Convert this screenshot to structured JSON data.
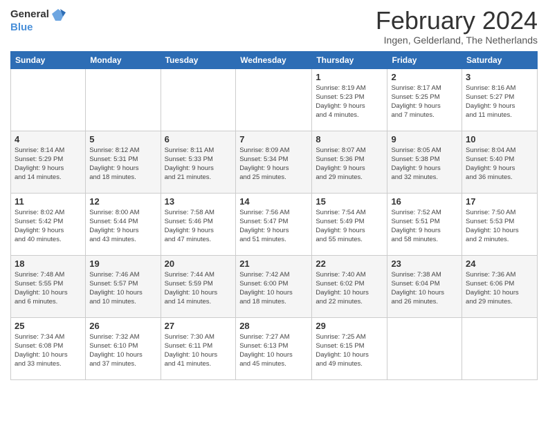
{
  "header": {
    "logo_line1": "General",
    "logo_line2": "Blue",
    "month_title": "February 2024",
    "location": "Ingen, Gelderland, The Netherlands"
  },
  "days_of_week": [
    "Sunday",
    "Monday",
    "Tuesday",
    "Wednesday",
    "Thursday",
    "Friday",
    "Saturday"
  ],
  "weeks": [
    {
      "days": [
        {
          "num": "",
          "info": ""
        },
        {
          "num": "",
          "info": ""
        },
        {
          "num": "",
          "info": ""
        },
        {
          "num": "",
          "info": ""
        },
        {
          "num": "1",
          "info": "Sunrise: 8:19 AM\nSunset: 5:23 PM\nDaylight: 9 hours\nand 4 minutes."
        },
        {
          "num": "2",
          "info": "Sunrise: 8:17 AM\nSunset: 5:25 PM\nDaylight: 9 hours\nand 7 minutes."
        },
        {
          "num": "3",
          "info": "Sunrise: 8:16 AM\nSunset: 5:27 PM\nDaylight: 9 hours\nand 11 minutes."
        }
      ]
    },
    {
      "days": [
        {
          "num": "4",
          "info": "Sunrise: 8:14 AM\nSunset: 5:29 PM\nDaylight: 9 hours\nand 14 minutes."
        },
        {
          "num": "5",
          "info": "Sunrise: 8:12 AM\nSunset: 5:31 PM\nDaylight: 9 hours\nand 18 minutes."
        },
        {
          "num": "6",
          "info": "Sunrise: 8:11 AM\nSunset: 5:33 PM\nDaylight: 9 hours\nand 21 minutes."
        },
        {
          "num": "7",
          "info": "Sunrise: 8:09 AM\nSunset: 5:34 PM\nDaylight: 9 hours\nand 25 minutes."
        },
        {
          "num": "8",
          "info": "Sunrise: 8:07 AM\nSunset: 5:36 PM\nDaylight: 9 hours\nand 29 minutes."
        },
        {
          "num": "9",
          "info": "Sunrise: 8:05 AM\nSunset: 5:38 PM\nDaylight: 9 hours\nand 32 minutes."
        },
        {
          "num": "10",
          "info": "Sunrise: 8:04 AM\nSunset: 5:40 PM\nDaylight: 9 hours\nand 36 minutes."
        }
      ]
    },
    {
      "days": [
        {
          "num": "11",
          "info": "Sunrise: 8:02 AM\nSunset: 5:42 PM\nDaylight: 9 hours\nand 40 minutes."
        },
        {
          "num": "12",
          "info": "Sunrise: 8:00 AM\nSunset: 5:44 PM\nDaylight: 9 hours\nand 43 minutes."
        },
        {
          "num": "13",
          "info": "Sunrise: 7:58 AM\nSunset: 5:46 PM\nDaylight: 9 hours\nand 47 minutes."
        },
        {
          "num": "14",
          "info": "Sunrise: 7:56 AM\nSunset: 5:47 PM\nDaylight: 9 hours\nand 51 minutes."
        },
        {
          "num": "15",
          "info": "Sunrise: 7:54 AM\nSunset: 5:49 PM\nDaylight: 9 hours\nand 55 minutes."
        },
        {
          "num": "16",
          "info": "Sunrise: 7:52 AM\nSunset: 5:51 PM\nDaylight: 9 hours\nand 58 minutes."
        },
        {
          "num": "17",
          "info": "Sunrise: 7:50 AM\nSunset: 5:53 PM\nDaylight: 10 hours\nand 2 minutes."
        }
      ]
    },
    {
      "days": [
        {
          "num": "18",
          "info": "Sunrise: 7:48 AM\nSunset: 5:55 PM\nDaylight: 10 hours\nand 6 minutes."
        },
        {
          "num": "19",
          "info": "Sunrise: 7:46 AM\nSunset: 5:57 PM\nDaylight: 10 hours\nand 10 minutes."
        },
        {
          "num": "20",
          "info": "Sunrise: 7:44 AM\nSunset: 5:59 PM\nDaylight: 10 hours\nand 14 minutes."
        },
        {
          "num": "21",
          "info": "Sunrise: 7:42 AM\nSunset: 6:00 PM\nDaylight: 10 hours\nand 18 minutes."
        },
        {
          "num": "22",
          "info": "Sunrise: 7:40 AM\nSunset: 6:02 PM\nDaylight: 10 hours\nand 22 minutes."
        },
        {
          "num": "23",
          "info": "Sunrise: 7:38 AM\nSunset: 6:04 PM\nDaylight: 10 hours\nand 26 minutes."
        },
        {
          "num": "24",
          "info": "Sunrise: 7:36 AM\nSunset: 6:06 PM\nDaylight: 10 hours\nand 29 minutes."
        }
      ]
    },
    {
      "days": [
        {
          "num": "25",
          "info": "Sunrise: 7:34 AM\nSunset: 6:08 PM\nDaylight: 10 hours\nand 33 minutes."
        },
        {
          "num": "26",
          "info": "Sunrise: 7:32 AM\nSunset: 6:10 PM\nDaylight: 10 hours\nand 37 minutes."
        },
        {
          "num": "27",
          "info": "Sunrise: 7:30 AM\nSunset: 6:11 PM\nDaylight: 10 hours\nand 41 minutes."
        },
        {
          "num": "28",
          "info": "Sunrise: 7:27 AM\nSunset: 6:13 PM\nDaylight: 10 hours\nand 45 minutes."
        },
        {
          "num": "29",
          "info": "Sunrise: 7:25 AM\nSunset: 6:15 PM\nDaylight: 10 hours\nand 49 minutes."
        },
        {
          "num": "",
          "info": ""
        },
        {
          "num": "",
          "info": ""
        }
      ]
    }
  ]
}
